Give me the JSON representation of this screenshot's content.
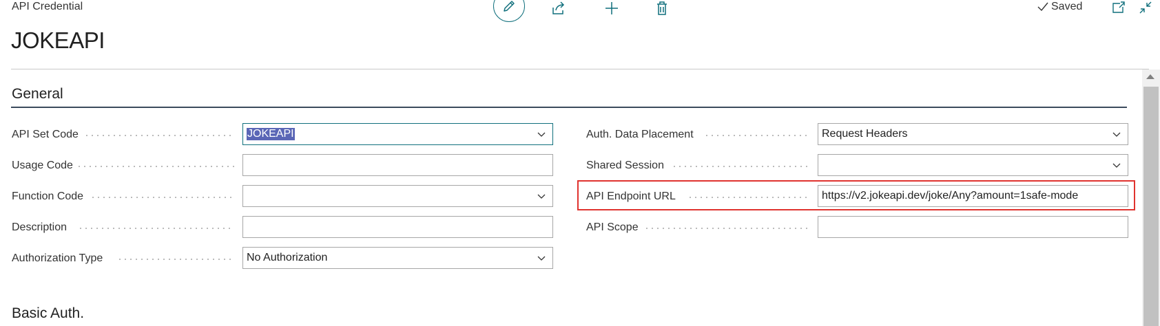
{
  "header": {
    "entity_label": "API Credential",
    "record_title": "JOKEAPI",
    "saved_status": "Saved",
    "actions": [
      {
        "name": "edit",
        "icon": "pencil-icon"
      },
      {
        "name": "share",
        "icon": "share-icon"
      },
      {
        "name": "new",
        "icon": "plus-icon"
      },
      {
        "name": "delete",
        "icon": "trash-icon"
      },
      {
        "name": "open-in-new-window",
        "icon": "open-new-window-icon"
      },
      {
        "name": "collapse",
        "icon": "collapse-icon"
      }
    ]
  },
  "general": {
    "title": "General",
    "left_fields": [
      {
        "label": "API Set Code",
        "value": "JOKEAPI",
        "type": "select",
        "selected": true
      },
      {
        "label": "Usage Code",
        "value": "",
        "type": "text"
      },
      {
        "label": "Function Code",
        "value": "",
        "type": "select"
      },
      {
        "label": "Description",
        "value": "",
        "type": "text"
      },
      {
        "label": "Authorization Type",
        "value": "No Authorization",
        "type": "select"
      }
    ],
    "right_fields": [
      {
        "label": "Auth. Data Placement",
        "value": "Request Headers",
        "type": "select"
      },
      {
        "label": "Shared Session",
        "value": "",
        "type": "select"
      },
      {
        "label": "API Endpoint URL",
        "value": "https://v2.jokeapi.dev/joke/Any?amount=1safe-mode",
        "type": "text",
        "highlighted": true
      },
      {
        "label": "API Scope",
        "value": "",
        "type": "text"
      }
    ]
  },
  "basic_auth": {
    "title": "Basic Auth."
  },
  "colors": {
    "accent": "#0f6f7c",
    "selection": "#5a66b6",
    "highlight": "#e0322e"
  }
}
